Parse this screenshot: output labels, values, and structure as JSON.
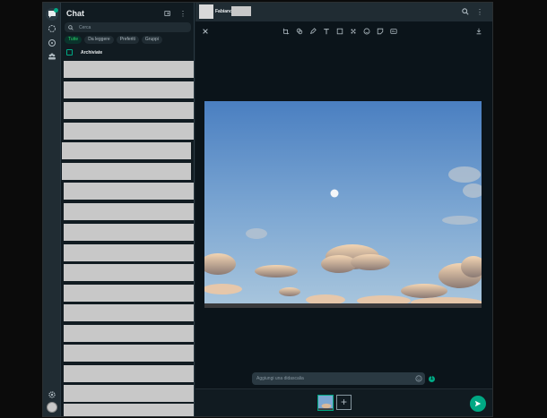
{
  "sidebar": {
    "title": "Chat",
    "search_placeholder": "Cerca",
    "filters": [
      "Tutte",
      "Da leggere",
      "Preferiti",
      "Gruppi"
    ],
    "archived_label": "Archiviate"
  },
  "conversation": {
    "contact_name": "Fabiano"
  },
  "editor": {
    "caption_placeholder": "Aggiungi una didascalia",
    "add_label": "+"
  },
  "colors": {
    "accent": "#00a884",
    "background": "#111b21",
    "panel": "#202c33"
  }
}
